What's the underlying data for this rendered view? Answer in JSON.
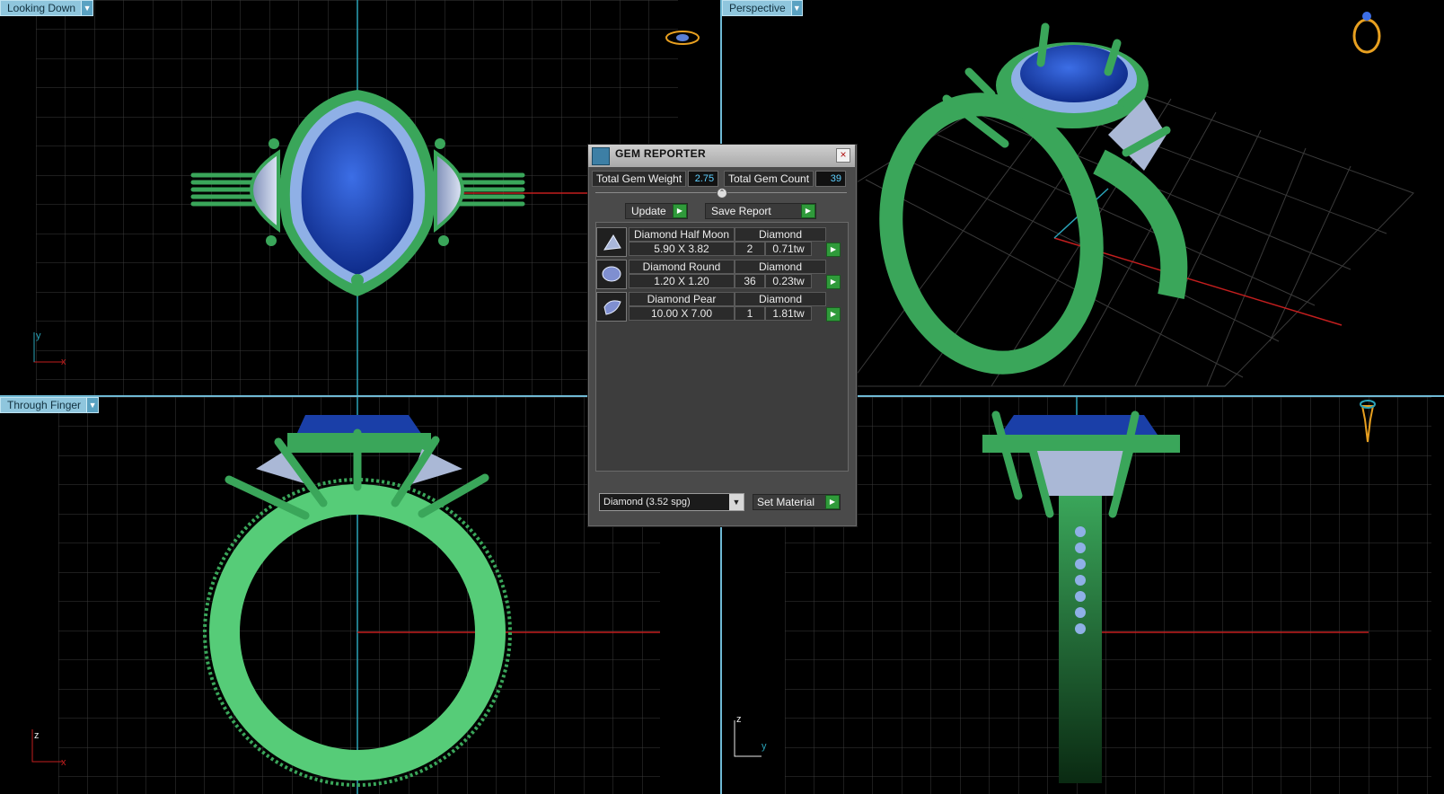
{
  "viewports": {
    "top_left": {
      "label": "Looking Down",
      "axis_1": "y",
      "axis_2": "x"
    },
    "top_right": {
      "label": "Perspective"
    },
    "bottom_left": {
      "label": "Through Finger",
      "axis_1": "z",
      "axis_2": "x"
    },
    "bottom_right": {
      "axis_1": "z",
      "axis_2": "y"
    }
  },
  "gem_reporter": {
    "title": "GEM REPORTER",
    "close_glyph": "×",
    "total_gem_weight_label": "Total Gem Weight",
    "total_gem_weight_value": "2.75",
    "total_gem_count_label": "Total Gem Count",
    "total_gem_count_value": "39",
    "update_label": "Update",
    "save_report_label": "Save Report",
    "gems": [
      {
        "name": "Diamond Half Moon",
        "material": "Diamond",
        "size": "5.90 X 3.82",
        "count": "2",
        "weight": "0.71tw",
        "icon": "half-moon-gem-icon"
      },
      {
        "name": "Diamond Round",
        "material": "Diamond",
        "size": "1.20 X 1.20",
        "count": "36",
        "weight": "0.23tw",
        "icon": "round-gem-icon"
      },
      {
        "name": "Diamond Pear",
        "material": "Diamond",
        "size": "10.00 X 7.00",
        "count": "1",
        "weight": "1.81tw",
        "icon": "pear-gem-icon"
      }
    ],
    "material_select_value": "Diamond    (3.52 spg)",
    "set_material_label": "Set Material"
  },
  "colors": {
    "viewport_border": "#6fb9d4",
    "metal_green": "#3aa65a",
    "gem_blue": "#1a3fa8",
    "diamond_white": "#aab8d6",
    "grid_line": "#3a3a3a",
    "axis_red": "#c21e1e",
    "axis_cyan": "#2aa3b8",
    "orientation_icon": "#e8a020"
  }
}
